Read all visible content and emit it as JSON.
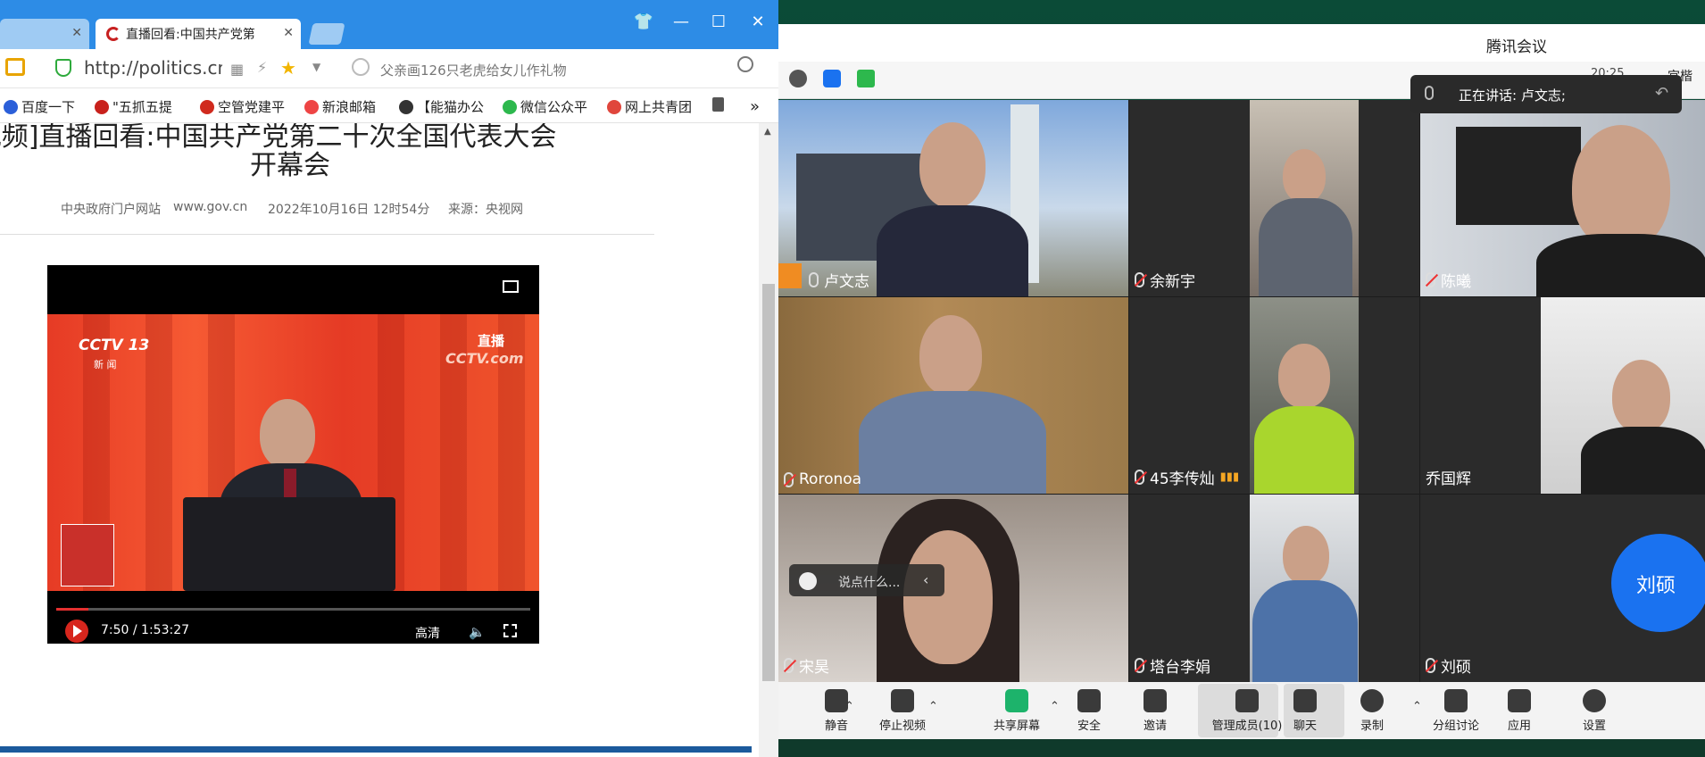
{
  "browser": {
    "tabs": [
      {
        "label": ""
      },
      {
        "label": "直播回看:中国共产党第"
      }
    ],
    "window_controls": {
      "skin": "👕",
      "minimize": "—",
      "maximize": "☐",
      "close": "✕"
    },
    "address_url": "http://politics.cntv",
    "search_placeholder": "父亲画126只老虎给女儿作礼物",
    "bookmarks": [
      "百度一下",
      "\"五抓五提",
      "空管党建平",
      "新浪邮箱",
      "【能猫办公",
      "微信公众平",
      "网上共青团"
    ],
    "bookmarks_more": "»"
  },
  "article": {
    "title_line1": "[视频]直播回看:中国共产党第二十次全国代表大会",
    "title_line2": "开幕会",
    "source_site": "中央政府门户网站",
    "source_domain": "www.gov.cn",
    "date": "2022年10月16日 12时54分",
    "origin": "来源：央视网"
  },
  "player": {
    "channel_logo": "CCTV 13",
    "channel_sub": "新 闻",
    "live_badge": "直播",
    "watermark": "CCTV.com",
    "time": "7:50 / 1:53:27",
    "progress": 0.068,
    "quality": "高清"
  },
  "meeting": {
    "app_title": "腾讯会议",
    "clock": "20:25",
    "host_name_partial": "宫楷",
    "speaking_label": "正在讲话: 卢文志;",
    "chat_placeholder": "说点什么...",
    "avatar_name": "刘硕",
    "participants": [
      {
        "name": "卢文志",
        "muted": false
      },
      {
        "name": "余新宇",
        "muted": true
      },
      {
        "name": "陈曦",
        "muted": true
      },
      {
        "name": "Roronoa",
        "muted": true
      },
      {
        "name": "45李传灿",
        "muted": true
      },
      {
        "name": "乔国辉",
        "muted": false
      },
      {
        "name": "宋昊",
        "muted": true
      },
      {
        "name": "塔台李娟",
        "muted": true
      },
      {
        "name": "刘硕",
        "muted": true
      }
    ],
    "toolbar": [
      {
        "label": "静音",
        "icon": "mic-icon"
      },
      {
        "label": "停止视频",
        "icon": "camera-icon"
      },
      {
        "label": "共享屏幕",
        "icon": "share-screen-icon"
      },
      {
        "label": "安全",
        "icon": "shield-icon"
      },
      {
        "label": "邀请",
        "icon": "invite-icon"
      },
      {
        "label": "管理成员(10)",
        "icon": "members-icon"
      },
      {
        "label": "聊天",
        "icon": "chat-icon"
      },
      {
        "label": "录制",
        "icon": "record-icon"
      },
      {
        "label": "分组讨论",
        "icon": "breakout-icon"
      },
      {
        "label": "应用",
        "icon": "apps-icon"
      },
      {
        "label": "设置",
        "icon": "gear-icon"
      }
    ]
  },
  "colors": {
    "browser_blue": "#2d8ce6",
    "meeting_blue": "#1a72f0",
    "live_red": "#e53030"
  }
}
